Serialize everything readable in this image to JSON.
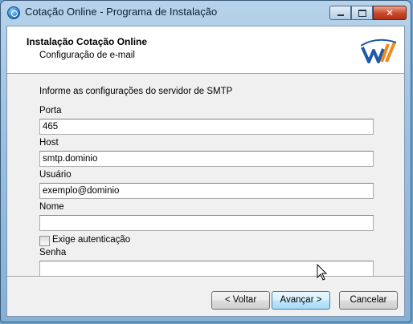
{
  "window": {
    "title": "Cotação Online - Programa de Instalação",
    "controls": {
      "minimize": "minimize",
      "maximize": "maximize",
      "close": "✕"
    }
  },
  "header": {
    "title": "Instalação Cotação Online",
    "subtitle": "Configuração de e-mail",
    "logo_icon": "wm-logo"
  },
  "form": {
    "intro": "Informe as configurações do servidor de SMTP",
    "porta": {
      "label": "Porta",
      "value": "465"
    },
    "host": {
      "label": "Host",
      "value": "smtp.dominio"
    },
    "usuario": {
      "label": "Usuário",
      "value": "exemplo@dominio"
    },
    "nome": {
      "label": "Nome",
      "value": ""
    },
    "auth": {
      "label": "Exige autenticação",
      "checked": false
    },
    "senha": {
      "label": "Senha",
      "value": ""
    }
  },
  "buttons": {
    "back": "< Voltar",
    "next": "Avançar >",
    "cancel": "Cancelar"
  },
  "colors": {
    "accent_blue": "#1d5aa8",
    "accent_orange": "#f08a1c",
    "desktop": "#6aa5cf"
  }
}
